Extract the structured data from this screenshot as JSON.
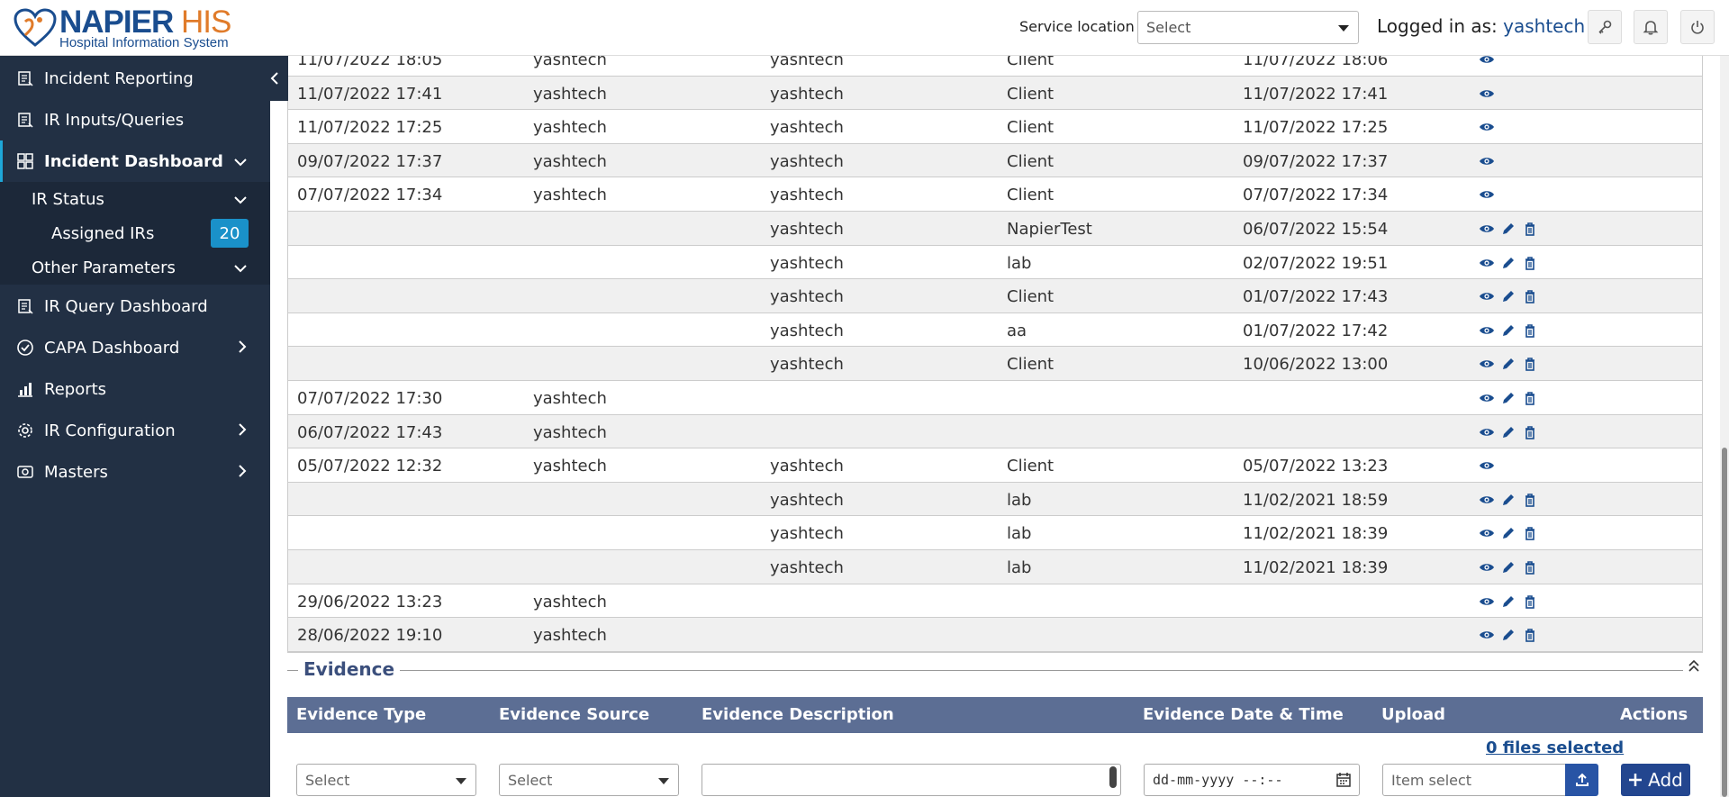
{
  "colors": {
    "brand": "#1a4d8f",
    "accent": "#e07b2a",
    "sidebar": "#223044",
    "badge": "#1a91c9",
    "table_header": "#5c6e94",
    "add_button": "#23468f"
  },
  "header": {
    "logo_name": "NAPIER",
    "logo_his": "HIS",
    "logo_sub": "Hospital Information System",
    "service_location_label": "Service location",
    "service_location_value": "Select",
    "logged_in_label": "Logged in as:",
    "username": "yashtech",
    "buttons": [
      "key-icon",
      "bell-icon",
      "power-icon"
    ]
  },
  "sidebar": {
    "items": [
      {
        "label": "Incident Reporting",
        "icon": "report-icon"
      },
      {
        "label": "IR Inputs/Queries",
        "icon": "report-icon"
      },
      {
        "label": "Incident Dashboard",
        "icon": "dashboard-icon",
        "active": true
      },
      {
        "label": "IR Query Dashboard",
        "icon": "report-icon"
      },
      {
        "label": "CAPA Dashboard",
        "icon": "check-circle-icon"
      },
      {
        "label": "Reports",
        "icon": "chart-icon"
      },
      {
        "label": "IR Configuration",
        "icon": "gear-icon"
      },
      {
        "label": "Masters",
        "icon": "masters-icon"
      }
    ],
    "subitems": {
      "ir_status": "IR Status",
      "assigned_irs": "Assigned IRs",
      "assigned_count": "20",
      "other_parameters": "Other Parameters"
    }
  },
  "grid": {
    "rows": [
      {
        "c1": "11/07/2022 18:05",
        "c2": "yashtech",
        "c3": "yashtech",
        "c4": "Client",
        "c5": "11/07/2022 18:06",
        "actions": [
          "view"
        ]
      },
      {
        "c1": "11/07/2022 17:41",
        "c2": "yashtech",
        "c3": "yashtech",
        "c4": "Client",
        "c5": "11/07/2022 17:41",
        "actions": [
          "view"
        ]
      },
      {
        "c1": "11/07/2022 17:25",
        "c2": "yashtech",
        "c3": "yashtech",
        "c4": "Client",
        "c5": "11/07/2022 17:25",
        "actions": [
          "view"
        ]
      },
      {
        "c1": "09/07/2022 17:37",
        "c2": "yashtech",
        "c3": "yashtech",
        "c4": "Client",
        "c5": "09/07/2022 17:37",
        "actions": [
          "view"
        ]
      },
      {
        "c1": "07/07/2022 17:34",
        "c2": "yashtech",
        "c3": "yashtech",
        "c4": "Client",
        "c5": "07/07/2022 17:34",
        "actions": [
          "view"
        ]
      },
      {
        "c1": "",
        "c2": "",
        "c3": "yashtech",
        "c4": "NapierTest",
        "c5": "06/07/2022 15:54",
        "actions": [
          "view",
          "edit",
          "delete"
        ]
      },
      {
        "c1": "",
        "c2": "",
        "c3": "yashtech",
        "c4": "lab",
        "c5": "02/07/2022 19:51",
        "actions": [
          "view",
          "edit",
          "delete"
        ]
      },
      {
        "c1": "",
        "c2": "",
        "c3": "yashtech",
        "c4": "Client",
        "c5": "01/07/2022 17:43",
        "actions": [
          "view",
          "edit",
          "delete"
        ]
      },
      {
        "c1": "",
        "c2": "",
        "c3": "yashtech",
        "c4": "aa",
        "c5": "01/07/2022 17:42",
        "actions": [
          "view",
          "edit",
          "delete"
        ]
      },
      {
        "c1": "",
        "c2": "",
        "c3": "yashtech",
        "c4": "Client",
        "c5": "10/06/2022 13:00",
        "actions": [
          "view",
          "edit",
          "delete"
        ]
      },
      {
        "c1": "07/07/2022 17:30",
        "c2": "yashtech",
        "c3": "",
        "c4": "",
        "c5": "",
        "actions": [
          "view",
          "edit",
          "delete"
        ]
      },
      {
        "c1": "06/07/2022 17:43",
        "c2": "yashtech",
        "c3": "",
        "c4": "",
        "c5": "",
        "actions": [
          "view",
          "edit",
          "delete"
        ]
      },
      {
        "c1": "05/07/2022 12:32",
        "c2": "yashtech",
        "c3": "yashtech",
        "c4": "Client",
        "c5": "05/07/2022 13:23",
        "actions": [
          "view"
        ]
      },
      {
        "c1": "",
        "c2": "",
        "c3": "yashtech",
        "c4": "lab",
        "c5": "11/02/2021 18:59",
        "actions": [
          "view",
          "edit",
          "delete"
        ]
      },
      {
        "c1": "",
        "c2": "",
        "c3": "yashtech",
        "c4": "lab",
        "c5": "11/02/2021 18:39",
        "actions": [
          "view",
          "edit",
          "delete"
        ]
      },
      {
        "c1": "",
        "c2": "",
        "c3": "yashtech",
        "c4": "lab",
        "c5": "11/02/2021 18:39",
        "actions": [
          "view",
          "edit",
          "delete"
        ]
      },
      {
        "c1": "29/06/2022 13:23",
        "c2": "yashtech",
        "c3": "",
        "c4": "",
        "c5": "",
        "actions": [
          "view",
          "edit",
          "delete"
        ]
      },
      {
        "c1": "28/06/2022 19:10",
        "c2": "yashtech",
        "c3": "",
        "c4": "",
        "c5": "",
        "actions": [
          "view",
          "edit",
          "delete"
        ]
      }
    ]
  },
  "evidence": {
    "title": "Evidence",
    "columns": [
      "Evidence Type",
      "Evidence Source",
      "Evidence Description",
      "Evidence Date & Time",
      "Upload",
      "Actions"
    ],
    "files_selected": "0 files selected",
    "type_value": "Select",
    "source_value": "Select",
    "description_value": "",
    "datetime_placeholder": "dd-mm-yyyy --:--",
    "upload_placeholder": "Item select",
    "add_label": "Add"
  }
}
